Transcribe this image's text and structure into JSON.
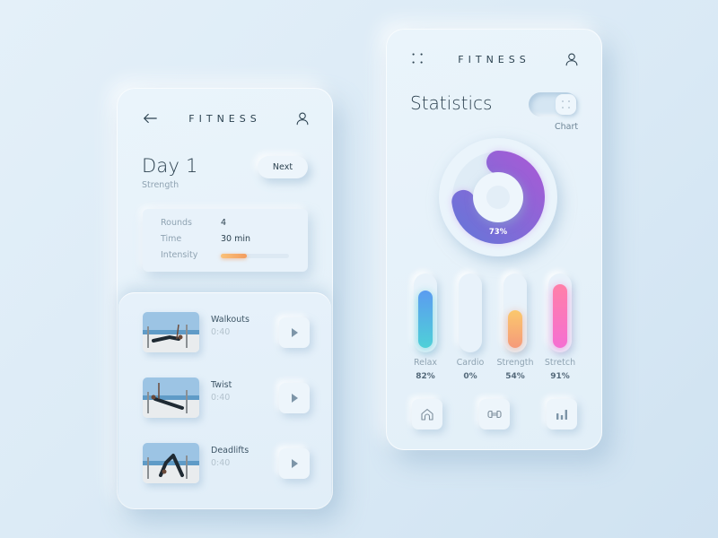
{
  "workout": {
    "header": {
      "brand": "FITNESS",
      "back_icon": "arrow-left-icon",
      "profile_icon": "user-icon"
    },
    "day_title": "Day 1",
    "day_subtitle": "Strength",
    "next_label": "Next",
    "stats": {
      "rounds_label": "Rounds",
      "rounds_value": "4",
      "time_label": "Time",
      "time_value": "30 min",
      "intensity_label": "Intensity",
      "intensity_fraction": 0.38
    },
    "exercises": [
      {
        "name": "Walkouts",
        "duration": "0:40"
      },
      {
        "name": "Twist",
        "duration": "0:40"
      },
      {
        "name": "Deadlifts",
        "duration": "0:40"
      }
    ]
  },
  "statistics": {
    "header": {
      "brand": "FITNESS",
      "menu_icon": "grid-dots-icon",
      "profile_icon": "user-icon"
    },
    "title": "Statistics",
    "toggle_label": "Chart",
    "donut": {
      "percent": 73,
      "label": "73%",
      "color_start": "#6b74d8",
      "color_end": "#a35cd6"
    },
    "categories": [
      {
        "label": "Relax",
        "percent": 82,
        "value_label": "82%",
        "color_top": "#5b9cf0",
        "color_bottom": "#4fd0d8"
      },
      {
        "label": "Cardio",
        "percent": 0,
        "value_label": "0%",
        "color_top": "#eef6fc",
        "color_bottom": "#eef6fc"
      },
      {
        "label": "Strength",
        "percent": 54,
        "value_label": "54%",
        "color_top": "#fbc86d",
        "color_bottom": "#f59a7a"
      },
      {
        "label": "Stretch",
        "percent": 91,
        "value_label": "91%",
        "color_top": "#ff7fa8",
        "color_bottom": "#f56fd2"
      }
    ],
    "nav": [
      "home-icon",
      "dumbbell-icon",
      "bar-chart-icon"
    ]
  }
}
